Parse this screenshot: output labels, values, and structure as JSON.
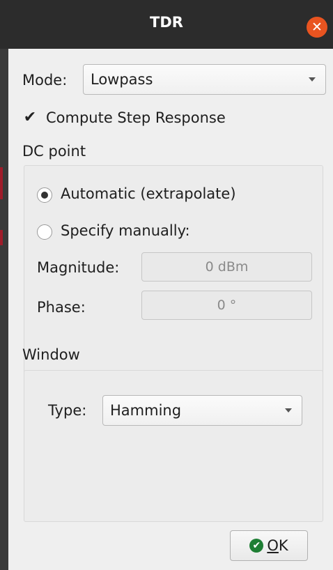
{
  "window": {
    "title": "TDR",
    "close_icon": "close-icon"
  },
  "mode": {
    "label": "Mode:",
    "value": "Lowpass"
  },
  "step_response": {
    "label": "Compute Step Response",
    "checked": true
  },
  "dc_point": {
    "heading": "DC point",
    "automatic_label": "Automatic (extrapolate)",
    "manual_label": "Specify manually:",
    "selected": "automatic",
    "magnitude_label": "Magnitude:",
    "magnitude_value": "0 dBm",
    "phase_label": "Phase:",
    "phase_value": "0 °"
  },
  "window_section": {
    "heading": "Window",
    "type_label": "Type:",
    "type_value": "Hamming"
  },
  "ok_button": {
    "mnemonic": "O",
    "rest": "K"
  },
  "colors": {
    "titlebar": "#2c2c2c",
    "close": "#e95420",
    "ok_icon": "#1e7e34"
  }
}
